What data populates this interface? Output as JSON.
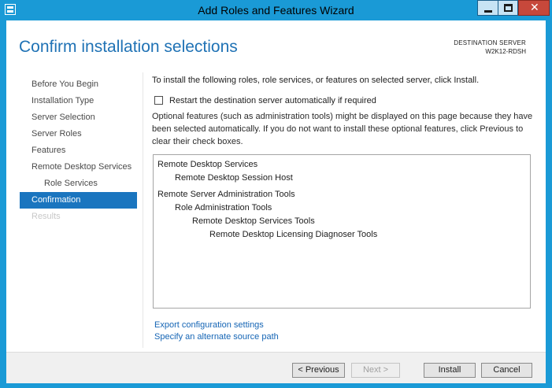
{
  "window": {
    "title": "Add Roles and Features Wizard",
    "close_glyph": "✕"
  },
  "header": {
    "page_title": "Confirm installation selections",
    "destination_label": "DESTINATION SERVER",
    "destination_server": "W2K12-RDSH"
  },
  "nav": {
    "items": [
      {
        "label": "Before You Begin",
        "state": "normal"
      },
      {
        "label": "Installation Type",
        "state": "normal"
      },
      {
        "label": "Server Selection",
        "state": "normal"
      },
      {
        "label": "Server Roles",
        "state": "normal"
      },
      {
        "label": "Features",
        "state": "normal"
      },
      {
        "label": "Remote Desktop Services",
        "state": "normal"
      },
      {
        "label": "Role Services",
        "state": "sub"
      },
      {
        "label": "Confirmation",
        "state": "active"
      },
      {
        "label": "Results",
        "state": "disabled"
      }
    ]
  },
  "content": {
    "intro": "To install the following roles, role services, or features on selected server, click Install.",
    "restart_checkbox": {
      "label": "Restart the destination server automatically if required",
      "checked": false
    },
    "info": "Optional features (such as administration tools) might be displayed on this page because they have been selected automatically. If you do not want to install these optional features, click Previous to clear their check boxes.",
    "selections": [
      {
        "label": "Remote Desktop Services",
        "level": 0
      },
      {
        "label": "Remote Desktop Session Host",
        "level": 1
      },
      {
        "label": "Remote Server Administration Tools",
        "level": 0
      },
      {
        "label": "Role Administration Tools",
        "level": 1
      },
      {
        "label": "Remote Desktop Services Tools",
        "level": 2
      },
      {
        "label": "Remote Desktop Licensing Diagnoser Tools",
        "level": 3
      }
    ],
    "links": {
      "export": "Export configuration settings",
      "alternate_source": "Specify an alternate source path"
    }
  },
  "footer": {
    "previous": "< Previous",
    "next": "Next >",
    "install": "Install",
    "cancel": "Cancel"
  },
  "colors": {
    "titlebar": "#1a9ad6",
    "accent_title": "#1f72b5",
    "nav_active": "#1a75bf",
    "link": "#1565b5",
    "close_button": "#c7483b"
  }
}
